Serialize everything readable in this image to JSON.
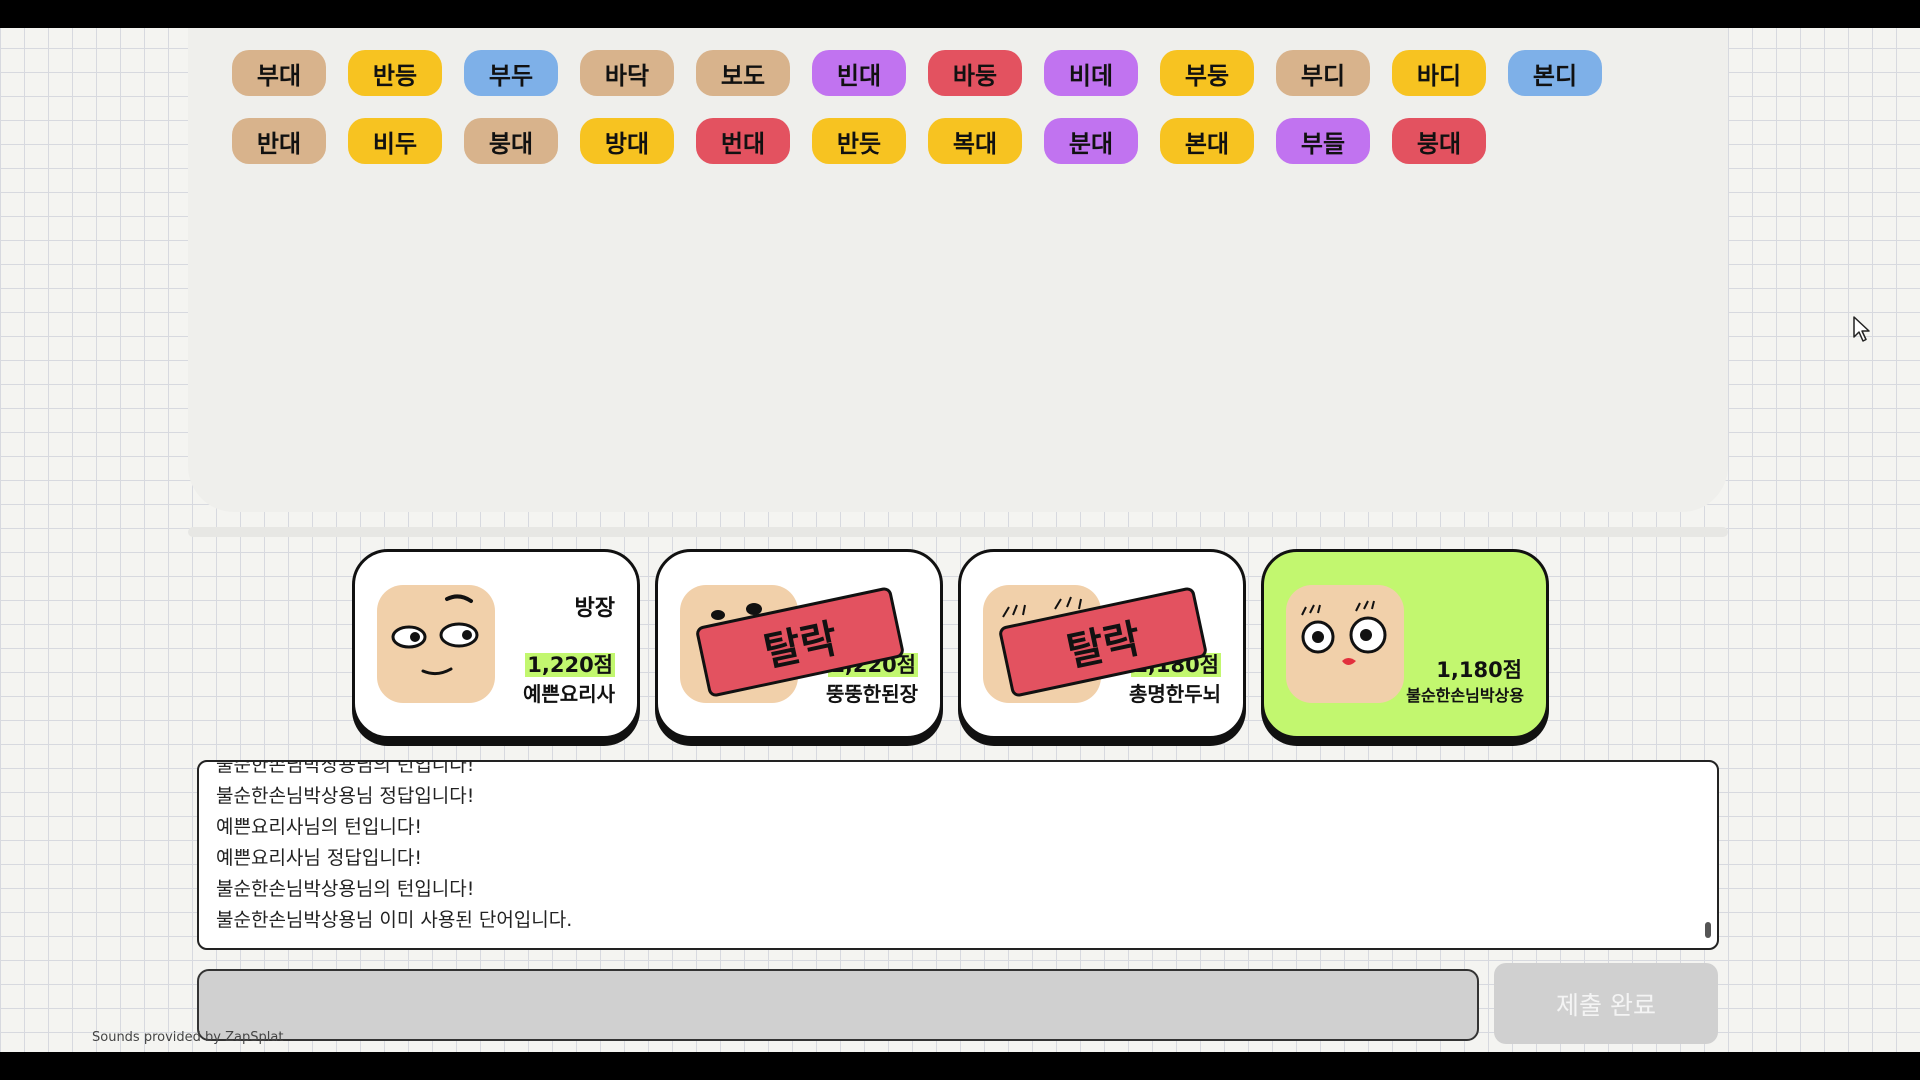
{
  "word_board": {
    "rows": [
      [
        {
          "text": "부대",
          "color": "#d8b38c"
        },
        {
          "text": "반등",
          "color": "#f7c321"
        },
        {
          "text": "부두",
          "color": "#7eb0e8"
        },
        {
          "text": "바닥",
          "color": "#d8b38c"
        },
        {
          "text": "보도",
          "color": "#d8b38c"
        },
        {
          "text": "빈대",
          "color": "#c173f0"
        },
        {
          "text": "바둥",
          "color": "#e35260"
        },
        {
          "text": "비데",
          "color": "#c173f0"
        },
        {
          "text": "부둥",
          "color": "#f7c321"
        },
        {
          "text": "부디",
          "color": "#d8b38c"
        },
        {
          "text": "바디",
          "color": "#f7c321"
        },
        {
          "text": "본디",
          "color": "#7eb0e8"
        }
      ],
      [
        {
          "text": "반대",
          "color": "#d8b38c"
        },
        {
          "text": "비두",
          "color": "#f7c321"
        },
        {
          "text": "붕대",
          "color": "#d8b38c"
        },
        {
          "text": "방대",
          "color": "#f7c321"
        },
        {
          "text": "번대",
          "color": "#e35260"
        },
        {
          "text": "반듯",
          "color": "#f7c321"
        },
        {
          "text": "복대",
          "color": "#f7c321"
        },
        {
          "text": "분대",
          "color": "#c173f0"
        },
        {
          "text": "본대",
          "color": "#f7c321"
        },
        {
          "text": "부들",
          "color": "#c173f0"
        },
        {
          "text": "붕대",
          "color": "#e35260"
        }
      ]
    ]
  },
  "players": [
    {
      "role": "방장",
      "score": "1,220점",
      "name": "예쁜요리사",
      "eliminated": false,
      "active": false,
      "face": "a"
    },
    {
      "role": "",
      "score": "1,220점",
      "name": "뚱뚱한된장",
      "eliminated": true,
      "active": false,
      "face": "b"
    },
    {
      "role": "",
      "score": "1,180점",
      "name": "총명한두뇌",
      "eliminated": true,
      "active": false,
      "face": "c"
    },
    {
      "role": "",
      "score": "1,180점",
      "name": "불순한손님박상용",
      "eliminated": false,
      "active": true,
      "face": "d"
    }
  ],
  "eliminated_label": "탈락",
  "log": {
    "lines": [
      "불순한손님박상용님의 턴입니다!",
      "불순한손님박상용님 정답입니다!",
      "예쁜요리사님의 턴입니다!",
      "예쁜요리사님 정답입니다!",
      "불순한손님박상용님의 턴입니다!",
      "불순한손님박상용님 이미 사용된 단어입니다."
    ]
  },
  "answer_input": {
    "value": "",
    "placeholder": ""
  },
  "submit_button": {
    "label": "제출 완료"
  },
  "credit": "Sounds provided by ZapSplat",
  "colors": {
    "accent_green": "#c2f76f",
    "eliminated_red": "#e35260",
    "skin": "#f1d0aa"
  }
}
